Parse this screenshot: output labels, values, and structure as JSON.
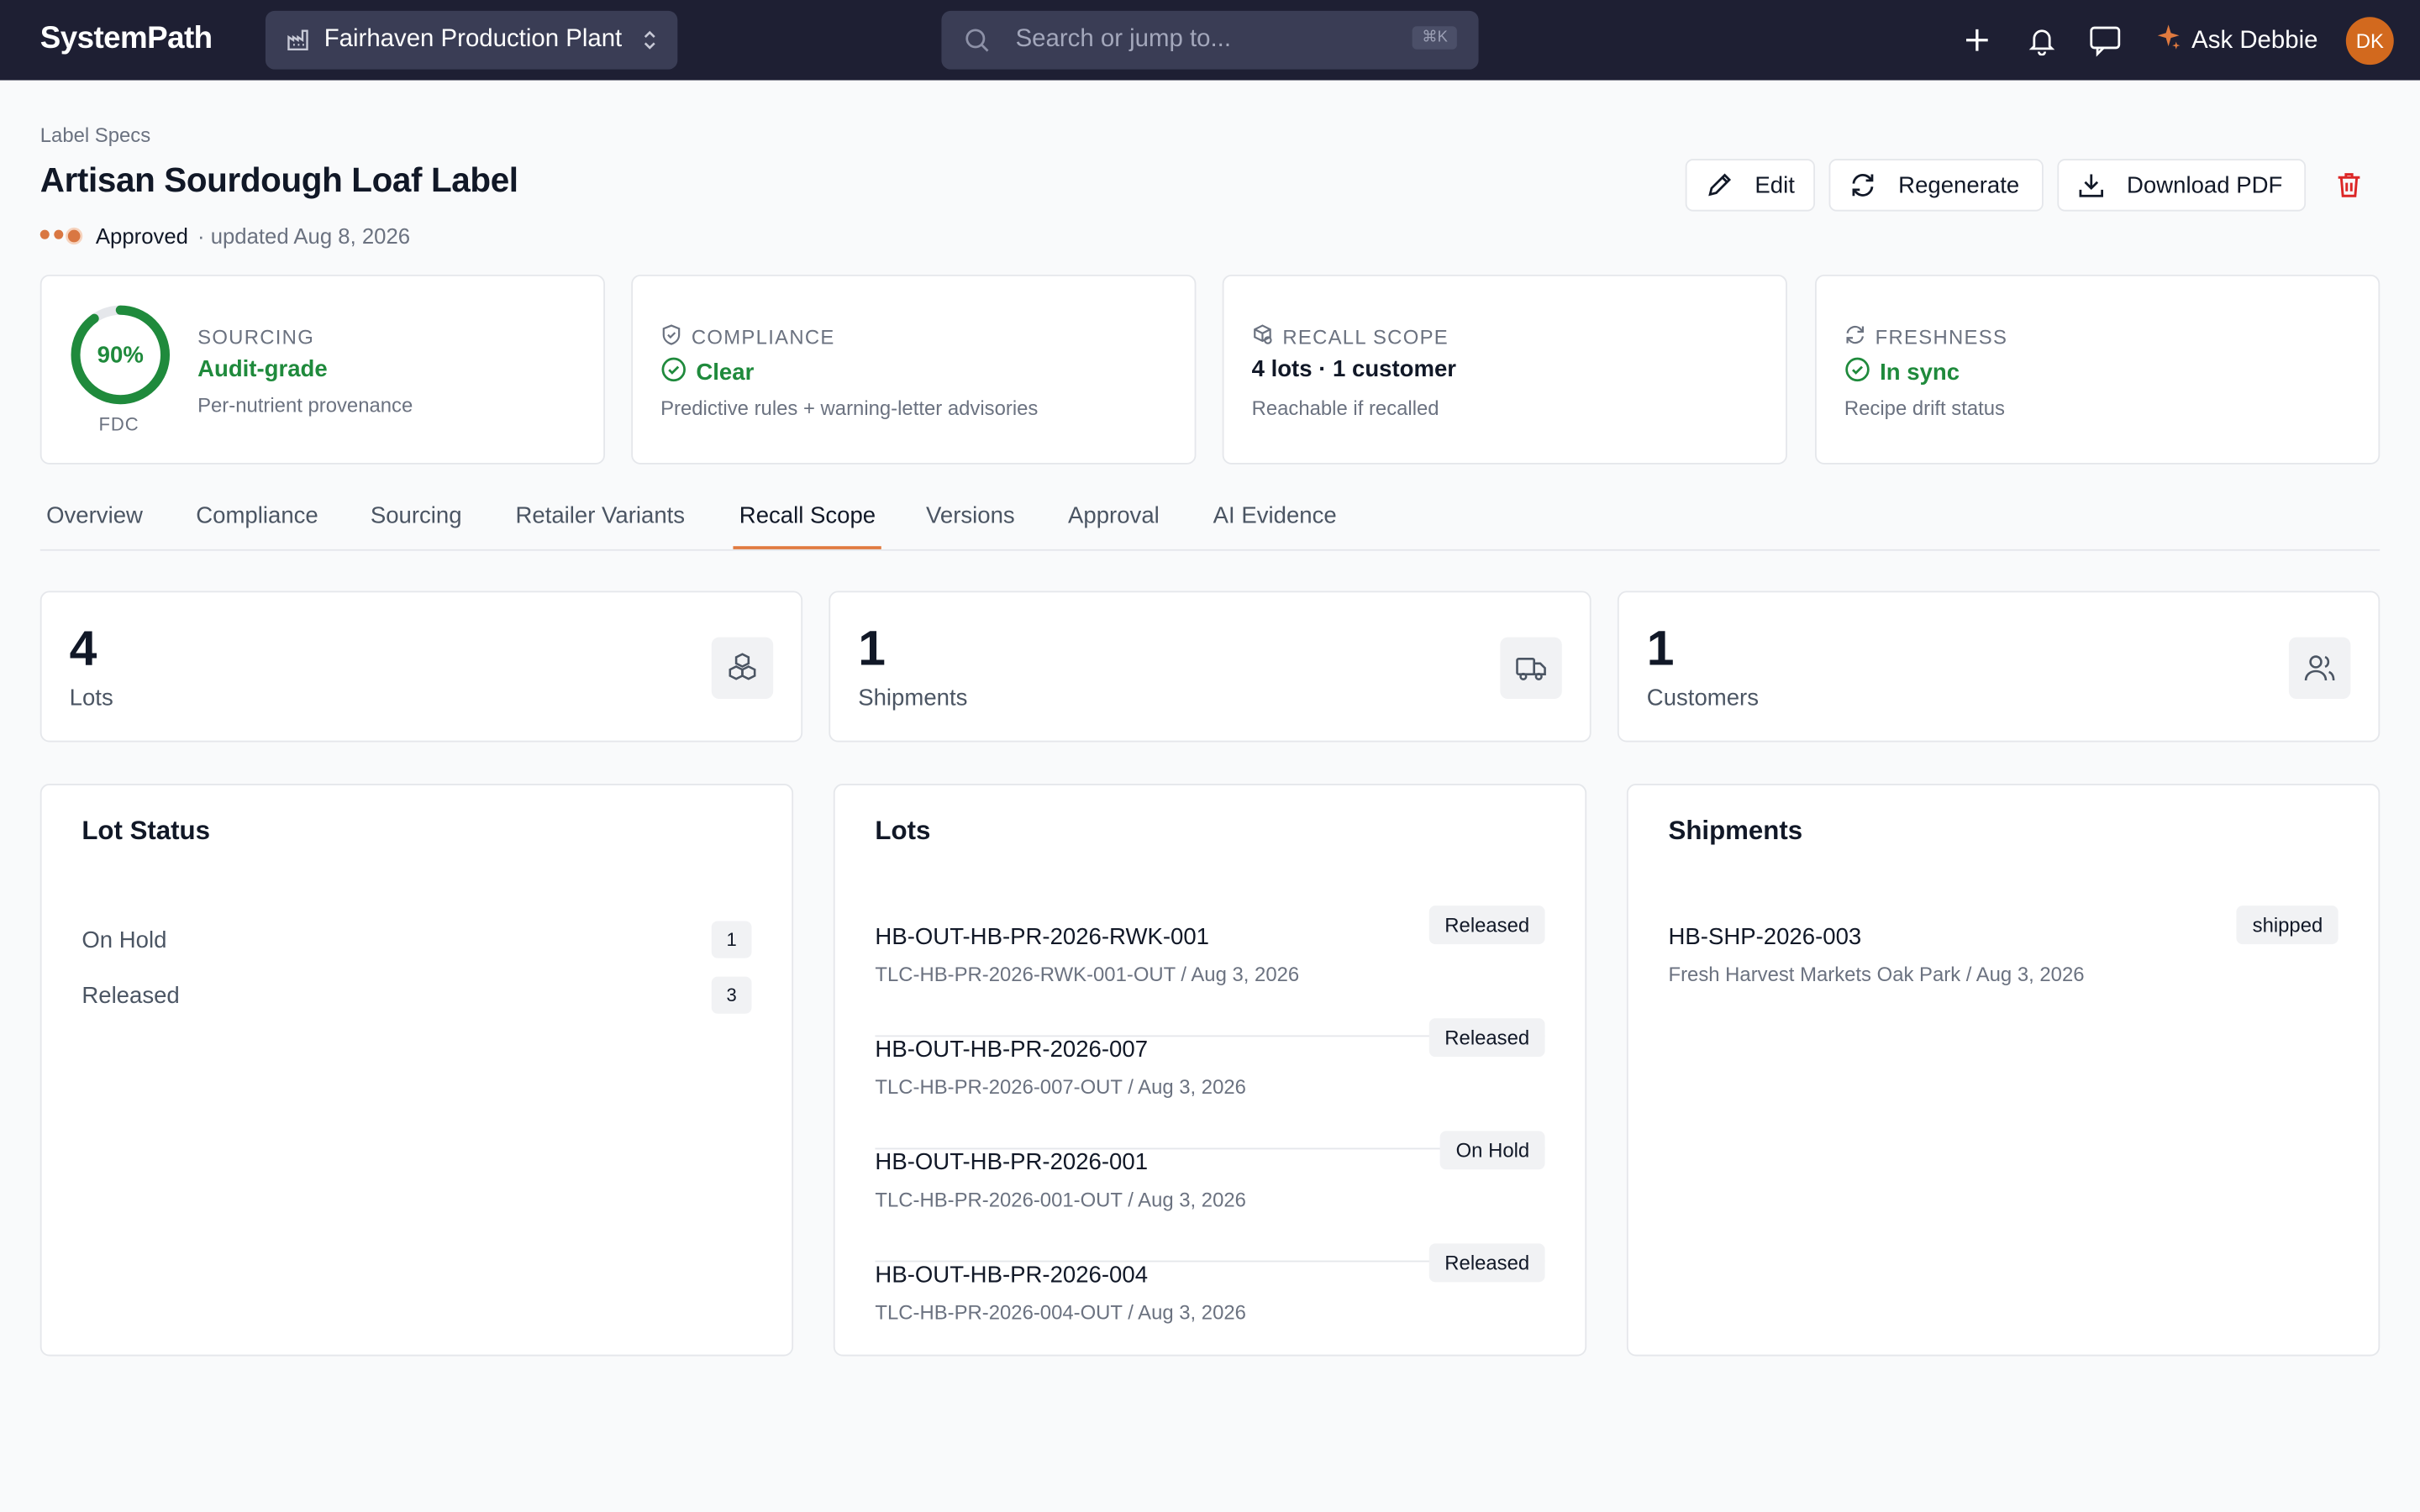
{
  "app": {
    "logo": "SystemPath",
    "plant_selector": "Fairhaven Production Plant",
    "search_placeholder": "Search or jump to...",
    "search_shortcut": "⌘K",
    "ask_label": "Ask Debbie",
    "avatar_initials": "DK"
  },
  "header": {
    "breadcrumb": "Label Specs",
    "title": "Artisan Sourdough Loaf Label",
    "status": "Approved",
    "updated": "· updated Aug 8, 2026",
    "buttons": {
      "edit": "Edit",
      "regenerate": "Regenerate",
      "download": "Download PDF"
    }
  },
  "metrics": {
    "sourcing": {
      "caption": "SOURCING",
      "percent_label": "90%",
      "percent_value": 0.9,
      "ring_label": "FDC",
      "value": "Audit-grade",
      "sub": "Per-nutrient provenance"
    },
    "compliance": {
      "caption": "COMPLIANCE",
      "value": "Clear",
      "sub": "Predictive rules + warning-letter advisories"
    },
    "recall": {
      "caption": "RECALL SCOPE",
      "value": "4 lots · 1 customer",
      "sub": "Reachable if recalled"
    },
    "freshness": {
      "caption": "FRESHNESS",
      "value": "In sync",
      "sub": "Recipe drift status"
    }
  },
  "tabs": [
    "Overview",
    "Compliance",
    "Sourcing",
    "Retailer Variants",
    "Recall Scope",
    "Versions",
    "Approval",
    "AI Evidence"
  ],
  "active_tab": "Recall Scope",
  "stats": [
    {
      "value": "4",
      "label": "Lots",
      "icon": "boxes-icon"
    },
    {
      "value": "1",
      "label": "Shipments",
      "icon": "truck-icon"
    },
    {
      "value": "1",
      "label": "Customers",
      "icon": "users-icon"
    }
  ],
  "lot_status": {
    "title": "Lot Status",
    "rows": [
      {
        "label": "On Hold",
        "count": "1"
      },
      {
        "label": "Released",
        "count": "3"
      }
    ]
  },
  "lots": {
    "title": "Lots",
    "items": [
      {
        "id": "HB-OUT-HB-PR-2026-RWK-001",
        "sub": "TLC-HB-PR-2026-RWK-001-OUT / Aug 3, 2026",
        "status": "Released"
      },
      {
        "id": "HB-OUT-HB-PR-2026-007",
        "sub": "TLC-HB-PR-2026-007-OUT / Aug 3, 2026",
        "status": "Released"
      },
      {
        "id": "HB-OUT-HB-PR-2026-001",
        "sub": "TLC-HB-PR-2026-001-OUT / Aug 3, 2026",
        "status": "On Hold"
      },
      {
        "id": "HB-OUT-HB-PR-2026-004",
        "sub": "TLC-HB-PR-2026-004-OUT / Aug 3, 2026",
        "status": "Released"
      }
    ]
  },
  "shipments": {
    "title": "Shipments",
    "items": [
      {
        "id": "HB-SHP-2026-003",
        "sub": "Fresh Harvest Markets Oak Park / Aug 3, 2026",
        "status": "shipped"
      }
    ]
  },
  "colors": {
    "topbar": "#1e1f33",
    "accent": "#e07a3f",
    "success": "#1f8a3c",
    "danger": "#dc2626"
  }
}
